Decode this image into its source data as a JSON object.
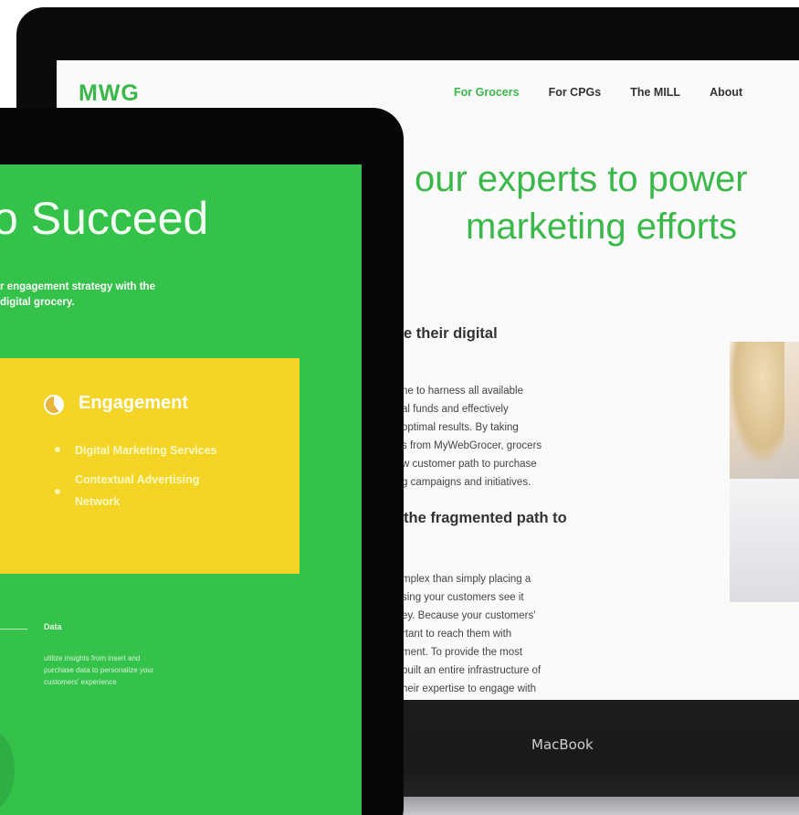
{
  "laptop": {
    "logo": "MWG",
    "nav": [
      "For Grocers",
      "For CPGs",
      "The MILL",
      "About"
    ],
    "hero_line1": "our experts to power",
    "hero_line2": "marketing efforts",
    "heading1": "e their digital",
    "para1": [
      "ne to harness all available",
      "al funds and effectively",
      "optimal results. By taking",
      "s from MyWebGrocer, grocers",
      "w customer path to purchase",
      "g campaigns and initiatives."
    ],
    "heading2": "the fragmented path to",
    "para2": [
      "mplex than simply placing a",
      "sing your customers see it",
      "ey. Because your customers'",
      "rtant to reach them with",
      "ment. To provide the most",
      "built an entire infrastructure of",
      "heir expertise to engage with"
    ],
    "macbook_label": "MacBook"
  },
  "tablet": {
    "title": "o Succeed",
    "subtitle": [
      "r engagement strategy with the",
      "digital grocery."
    ],
    "card": {
      "title": "Engagement",
      "items": [
        "Digital Marketing Services",
        "Contextual Advertising",
        "Network"
      ]
    },
    "data_label": "Data",
    "data_desc": [
      "utilize insights from insert and",
      "purchase data to personalize your",
      "customers' experience"
    ]
  },
  "colors": {
    "brand_green": "#3bb84a",
    "tablet_green": "#34c24a",
    "card_yellow": "#f4d424"
  }
}
